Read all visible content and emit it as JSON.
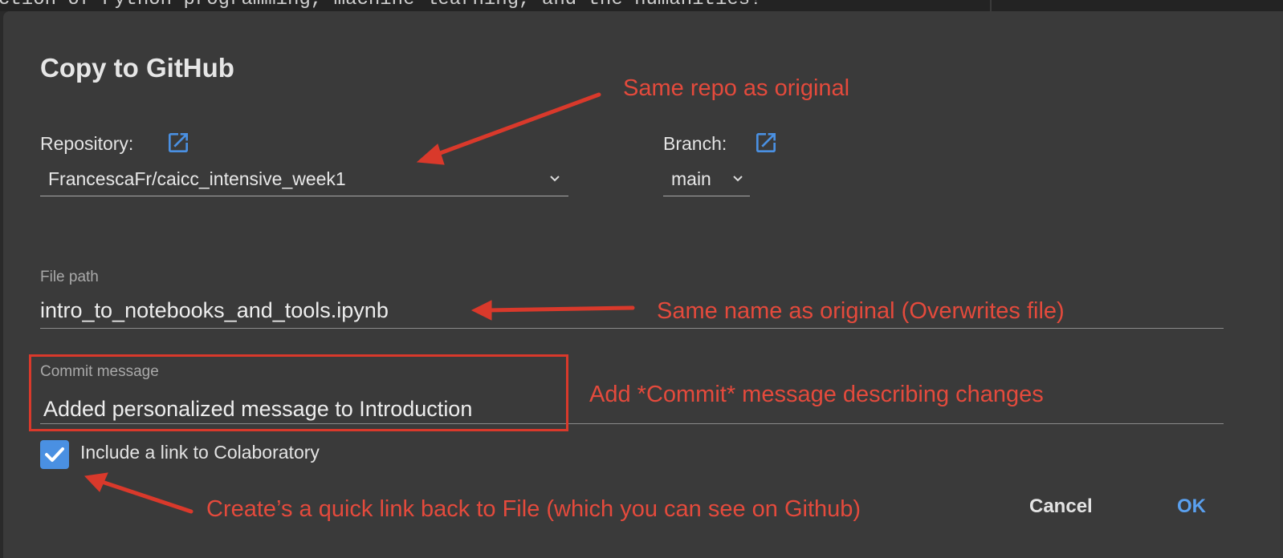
{
  "background": {
    "code_text": "ction of Python programming, machine learning, and the humanities!"
  },
  "dialog": {
    "title": "Copy to GitHub",
    "repository": {
      "label": "Repository:",
      "value": "FrancescaFr/caicc_intensive_week1",
      "open_icon": "open-in-new-icon"
    },
    "branch": {
      "label": "Branch:",
      "value": "main",
      "open_icon": "open-in-new-icon"
    },
    "file_path": {
      "label": "File path",
      "value": "intro_to_notebooks_and_tools.ipynb"
    },
    "commit_message": {
      "label": "Commit message",
      "value": "Added personalized message to Introduction"
    },
    "include_link": {
      "label": "Include a link to Colaboratory",
      "checked": true
    },
    "buttons": {
      "cancel": "Cancel",
      "ok": "OK"
    }
  },
  "annotations": {
    "repo_note": "Same repo as original",
    "name_note": "Same name as original (Overwrites file)",
    "commit_note": "Add *Commit* message describing changes",
    "link_note": "Create’s a quick link back to File (which you can see on Github)"
  },
  "colors": {
    "dialog_bg": "#3a3a3a",
    "annotation": "#e44a3c",
    "accent_blue": "#4a90e2",
    "ok_blue": "#5aa0ef"
  }
}
